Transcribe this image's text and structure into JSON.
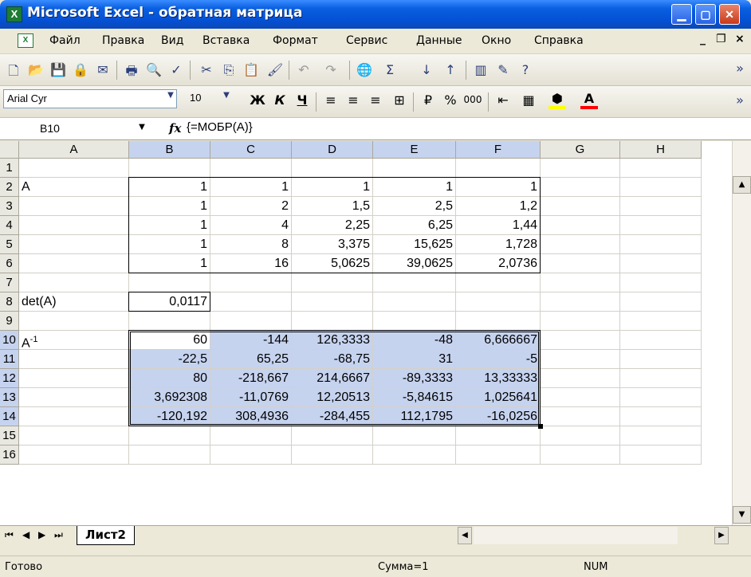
{
  "window": {
    "title": "Microsoft Excel - обратная матрица"
  },
  "menu": [
    "Файл",
    "Правка",
    "Вид",
    "Вставка",
    "Формат",
    "Сервис",
    "Данные",
    "Окно",
    "Справка"
  ],
  "toolbar": {
    "font_name": "Arial Cyr",
    "font_size": "10"
  },
  "formula_bar": {
    "name_box": "B10",
    "fx": "fx",
    "formula": "{=МОБР(A)}"
  },
  "columns": [
    "A",
    "B",
    "C",
    "D",
    "E",
    "F",
    "G",
    "H"
  ],
  "selected_columns": [
    "B",
    "C",
    "D",
    "E",
    "F"
  ],
  "rows": [
    "1",
    "2",
    "3",
    "4",
    "5",
    "6",
    "7",
    "8",
    "9",
    "10",
    "11",
    "12",
    "13",
    "14",
    "15",
    "16"
  ],
  "selected_rows": [
    "10",
    "11",
    "12",
    "13",
    "14"
  ],
  "cells": {
    "A2": "A",
    "A8": "det(A)",
    "A10": "A",
    "A10_sup": "-1",
    "B2": "1",
    "C2": "1",
    "D2": "1",
    "E2": "1",
    "F2": "1",
    "B3": "1",
    "C3": "2",
    "D3": "1,5",
    "E3": "2,5",
    "F3": "1,2",
    "B4": "1",
    "C4": "4",
    "D4": "2,25",
    "E4": "6,25",
    "F4": "1,44",
    "B5": "1",
    "C5": "8",
    "D5": "3,375",
    "E5": "15,625",
    "F5": "1,728",
    "B6": "1",
    "C6": "16",
    "D6": "5,0625",
    "E6": "39,0625",
    "F6": "2,0736",
    "B8": "0,0117",
    "B10": "60",
    "C10": "-144",
    "D10": "126,3333",
    "E10": "-48",
    "F10": "6,666667",
    "B11": "-22,5",
    "C11": "65,25",
    "D11": "-68,75",
    "E11": "31",
    "F11": "-5",
    "B12": "80",
    "C12": "-218,667",
    "D12": "214,6667",
    "E12": "-89,3333",
    "F12": "13,33333",
    "B13": "3,692308",
    "C13": "-11,0769",
    "D13": "12,20513",
    "E13": "-5,84615",
    "F13": "1,025641",
    "B14": "-120,192",
    "C14": "308,4936",
    "D14": "-284,455",
    "E14": "112,1795",
    "F14": "-16,0256"
  },
  "sheet_tabs": [
    "Лист2"
  ],
  "status": {
    "ready": "Готово",
    "sum": "Сумма=1",
    "num": "NUM"
  }
}
